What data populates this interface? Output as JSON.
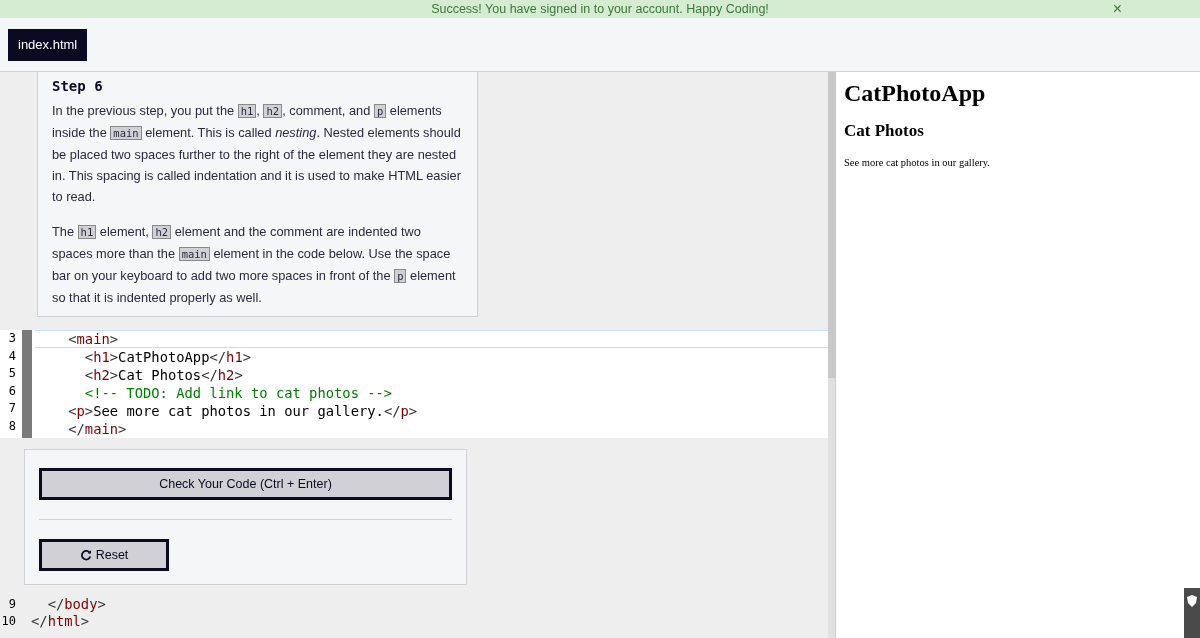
{
  "banner": {
    "message": "Success! You have signed in to your account. Happy Coding!",
    "close": "×"
  },
  "tabs": [
    {
      "label": "index.html",
      "selected": true
    }
  ],
  "instructions": {
    "title": "Step 6",
    "paragraphs": [
      [
        {
          "kind": "text",
          "text": "In the previous step, you put the "
        },
        {
          "kind": "code",
          "text": "h1"
        },
        {
          "kind": "text",
          "text": ", "
        },
        {
          "kind": "code",
          "text": "h2"
        },
        {
          "kind": "text",
          "text": ", comment, and "
        },
        {
          "kind": "code",
          "text": "p"
        },
        {
          "kind": "text",
          "text": " elements inside the "
        },
        {
          "kind": "code",
          "text": "main"
        },
        {
          "kind": "text",
          "text": " element. This is called "
        },
        {
          "kind": "em",
          "text": "nesting"
        },
        {
          "kind": "text",
          "text": ". Nested elements should be placed two spaces further to the right of the element they are nested in. This spacing is called indentation and it is used to make HTML easier to read."
        }
      ],
      [
        {
          "kind": "text",
          "text": "The "
        },
        {
          "kind": "code",
          "text": "h1"
        },
        {
          "kind": "text",
          "text": " element, "
        },
        {
          "kind": "code",
          "text": "h2"
        },
        {
          "kind": "text",
          "text": " element and the comment are indented two spaces more than the "
        },
        {
          "kind": "code",
          "text": "main"
        },
        {
          "kind": "text",
          "text": " element in the code below. Use the space bar on your keyboard to add two more spaces in front of the "
        },
        {
          "kind": "code",
          "text": "p"
        },
        {
          "kind": "text",
          "text": " element so that it is indented properly as well."
        }
      ]
    ]
  },
  "editor_lines": [
    {
      "number": "3",
      "kind": "markup",
      "text": "    <main>",
      "active": true
    },
    {
      "number": "4",
      "kind": "markup",
      "text": "      <h1>CatPhotoApp</h1>",
      "active": false
    },
    {
      "number": "5",
      "kind": "markup",
      "text": "      <h2>Cat Photos</h2>",
      "active": false
    },
    {
      "number": "6",
      "kind": "comment",
      "text": "      <!-- TODO: Add link to cat photos -->",
      "active": false
    },
    {
      "number": "7",
      "kind": "markup",
      "text": "    <p>See more cat photos in our gallery.</p>",
      "active": false
    },
    {
      "number": "8",
      "kind": "markup",
      "text": "    </main>",
      "active": false
    }
  ],
  "actions": {
    "check": "Check Your Code (Ctrl + Enter)",
    "reset": "Reset"
  },
  "trailing_lines": [
    {
      "number": "9",
      "kind": "markup",
      "text": "  </body>",
      "active": false
    },
    {
      "number": "10",
      "kind": "markup",
      "text": "</html>",
      "active": false
    }
  ],
  "preview": {
    "heading": "CatPhotoApp",
    "subheading": "Cat Photos",
    "paragraph": "See more cat photos in our gallery."
  }
}
